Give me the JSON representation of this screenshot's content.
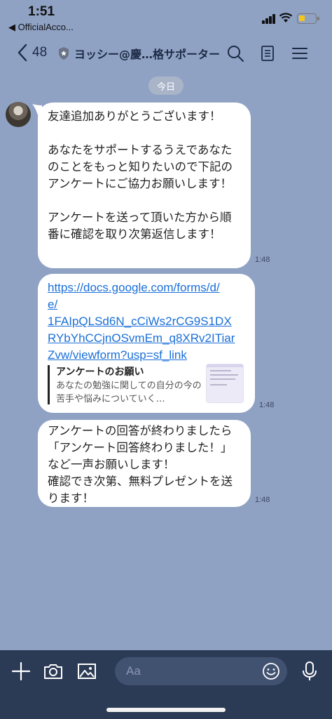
{
  "status_bar": {
    "time": "1:51",
    "back_app": "◀ OfficialAcco..."
  },
  "header": {
    "back_count": "48",
    "title": "ヨッシー@慶…格サポーター",
    "icons": [
      "search-icon",
      "notes-icon",
      "menu-icon"
    ]
  },
  "date_divider": "今日",
  "messages": [
    {
      "text": "友達追加ありがとうございます！\n\nあなたをサポートするうえであなた\nのことをもっと知りたいので下記の\nアンケートにご協力お願いします！\n\nアンケートを送って頂いた方から順\n番に確認を取り次第返信します！",
      "time": "1:48"
    },
    {
      "link": "https://docs.google.com/forms/d/e/1FAIpQLSd6N_cCiWs2rCG9S1DXRYbYhCCjnOSvmEm_q8XRv2ITiarZvw/viewform?usp=sf_link",
      "link_lines": [
        "https://docs.google.com/forms/d/",
        "e/",
        "1FAIpQLSd6N_cCiWs2rCG9S1DX",
        "RYbYhCCjnOSvmEm_q8XRv2ITiar",
        "Zvw/viewform?usp=sf_link"
      ],
      "preview_title": "アンケートのお願い",
      "preview_desc": "あなたの勉強に関しての自分の今の苦手や悩みについていく…",
      "time": "1:48"
    },
    {
      "text": "アンケートの回答が終わりましたら\n「アンケート回答終わりました！」\nなど一声お願いします！\n確認でき次第、無料プレゼントを送\nります！",
      "time": "1:48"
    }
  ],
  "input": {
    "placeholder": "Aa"
  },
  "colors": {
    "chat_bg": "#8fa2c4",
    "bottom_bar": "#2b3a55",
    "link": "#1a6fd8"
  }
}
